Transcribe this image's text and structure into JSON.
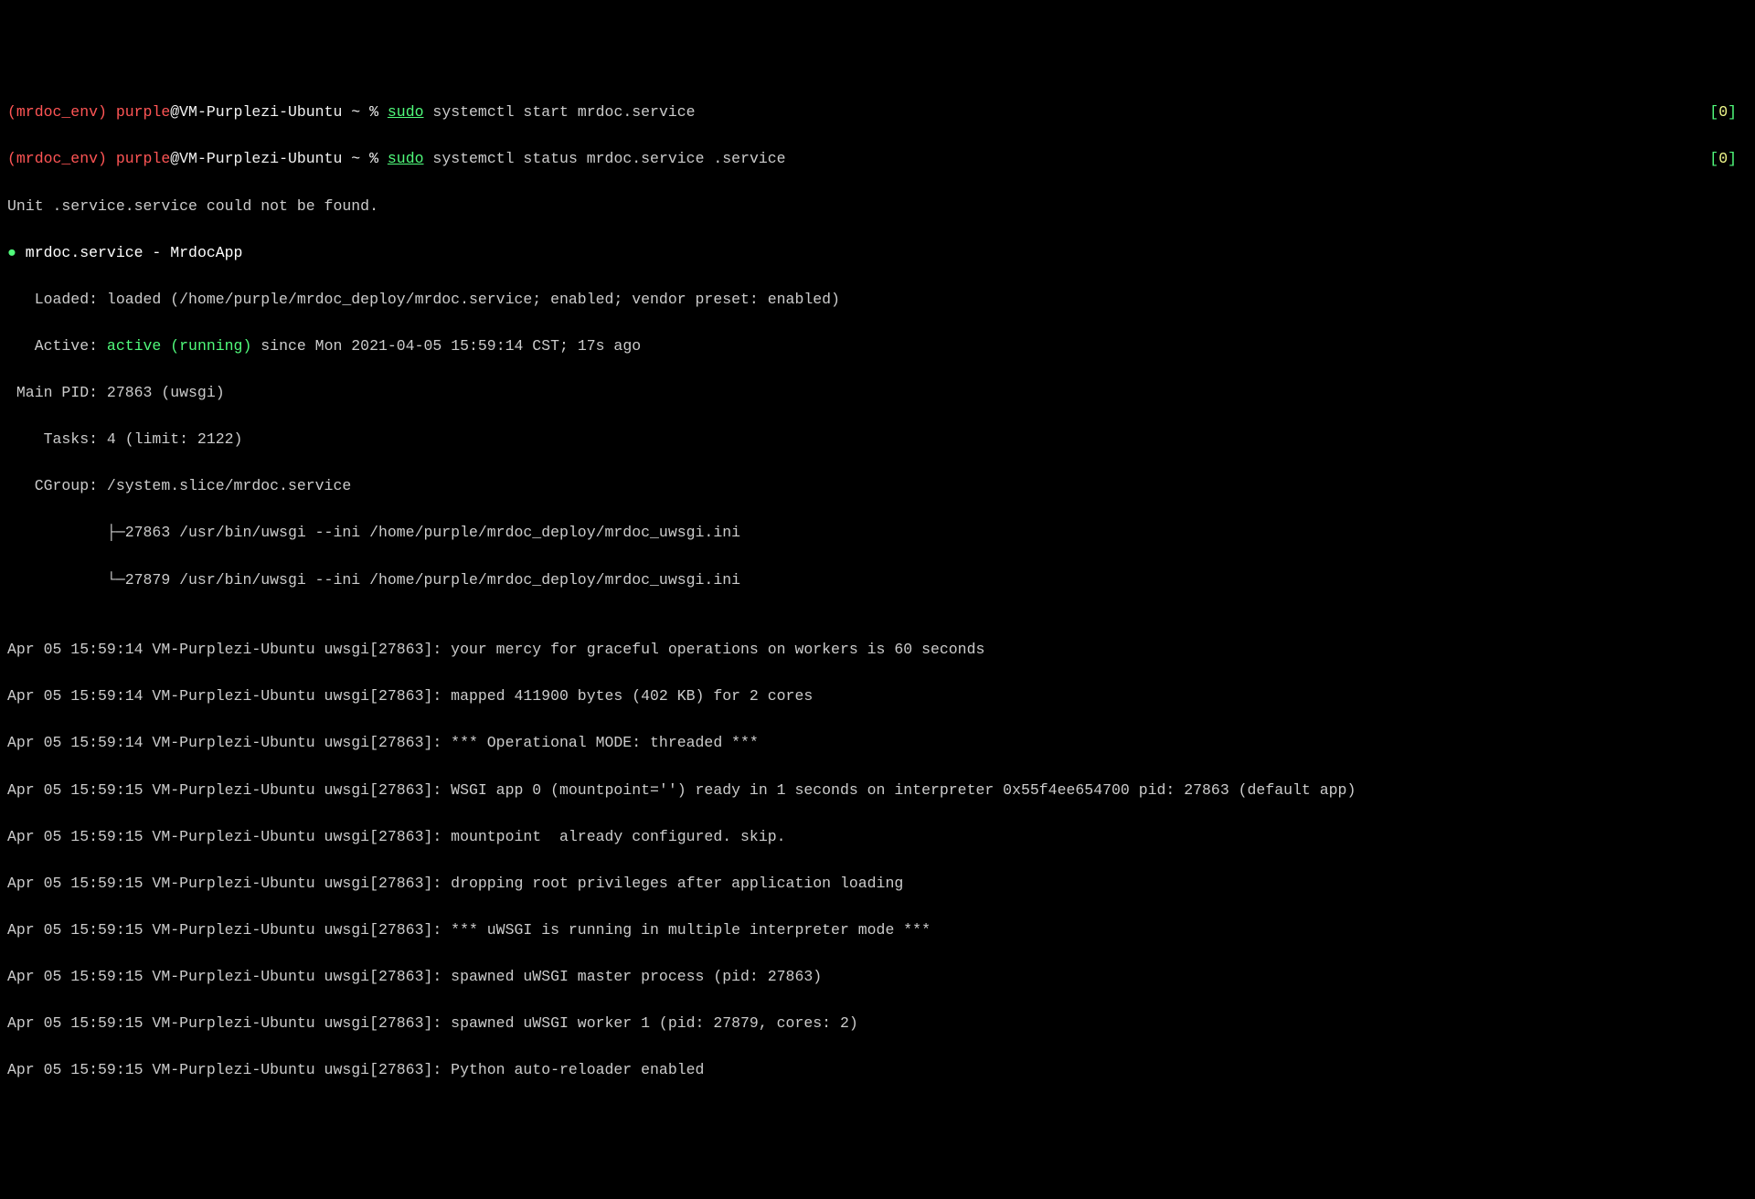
{
  "prompt1": {
    "env": "(mrdoc_env) ",
    "user": "purple",
    "at_host": "@VM-Purplezi-Ubuntu",
    "path_symbol": " ~ % ",
    "sudo": "sudo",
    "cmd_rest": " systemctl start mrdoc.service",
    "indicator_open": "[",
    "indicator_val": "0",
    "indicator_close": "]"
  },
  "prompt2": {
    "env": "(mrdoc_env) ",
    "user": "purple",
    "at_host": "@VM-Purplezi-Ubuntu",
    "path_symbol": " ~ % ",
    "sudo": "sudo",
    "cmd_rest": " systemctl status mrdoc.service .service",
    "indicator_open": "[",
    "indicator_val": "0",
    "indicator_close": "]"
  },
  "output": {
    "not_found": "Unit .service.service could not be found.",
    "dot": "●",
    "service_title": " mrdoc.service - MrdocApp",
    "loaded": "   Loaded: loaded (/home/purple/mrdoc_deploy/mrdoc.service; enabled; vendor preset: enabled)",
    "active_prefix": "   Active: ",
    "active_status": "active (running)",
    "active_suffix": " since Mon 2021-04-05 15:59:14 CST; 17s ago",
    "main_pid": " Main PID: 27863 (uwsgi)",
    "tasks": "    Tasks: 4 (limit: 2122)",
    "cgroup": "   CGroup: /system.slice/mrdoc.service",
    "tree1": "           ├─27863 /usr/bin/uwsgi --ini /home/purple/mrdoc_deploy/mrdoc_uwsgi.ini",
    "tree2": "           └─27879 /usr/bin/uwsgi --ini /home/purple/mrdoc_deploy/mrdoc_uwsgi.ini",
    "blank": "",
    "log1": "Apr 05 15:59:14 VM-Purplezi-Ubuntu uwsgi[27863]: your mercy for graceful operations on workers is 60 seconds",
    "log2": "Apr 05 15:59:14 VM-Purplezi-Ubuntu uwsgi[27863]: mapped 411900 bytes (402 KB) for 2 cores",
    "log3": "Apr 05 15:59:14 VM-Purplezi-Ubuntu uwsgi[27863]: *** Operational MODE: threaded ***",
    "log4": "Apr 05 15:59:15 VM-Purplezi-Ubuntu uwsgi[27863]: WSGI app 0 (mountpoint='') ready in 1 seconds on interpreter 0x55f4ee654700 pid: 27863 (default app)",
    "log5": "Apr 05 15:59:15 VM-Purplezi-Ubuntu uwsgi[27863]: mountpoint  already configured. skip.",
    "log6": "Apr 05 15:59:15 VM-Purplezi-Ubuntu uwsgi[27863]: dropping root privileges after application loading",
    "log7": "Apr 05 15:59:15 VM-Purplezi-Ubuntu uwsgi[27863]: *** uWSGI is running in multiple interpreter mode ***",
    "log8": "Apr 05 15:59:15 VM-Purplezi-Ubuntu uwsgi[27863]: spawned uWSGI master process (pid: 27863)",
    "log9": "Apr 05 15:59:15 VM-Purplezi-Ubuntu uwsgi[27863]: spawned uWSGI worker 1 (pid: 27879, cores: 2)",
    "log10": "Apr 05 15:59:15 VM-Purplezi-Ubuntu uwsgi[27863]: Python auto-reloader enabled"
  }
}
